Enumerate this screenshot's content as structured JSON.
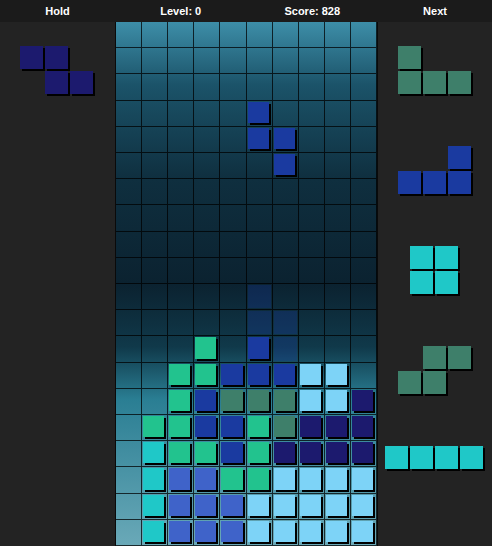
{
  "header": {
    "hold_label": "Hold",
    "level": "Level: 0",
    "score": "Score: 828",
    "next_label": "Next"
  },
  "hold": {
    "color": "#1c1a6e",
    "cells": [
      [
        0,
        0
      ],
      [
        1,
        0
      ],
      [
        1,
        1
      ],
      [
        2,
        1
      ]
    ]
  },
  "next": [
    {
      "color": "#3e7f6a",
      "cells": [
        [
          0,
          0
        ],
        [
          0,
          1
        ],
        [
          1,
          1
        ],
        [
          2,
          1
        ]
      ]
    },
    {
      "color": "#1a3aa0",
      "cells": [
        [
          2,
          0
        ],
        [
          0,
          1
        ],
        [
          1,
          1
        ],
        [
          2,
          1
        ]
      ]
    },
    {
      "color": "#1fc8c8",
      "cells": [
        [
          0,
          0
        ],
        [
          1,
          0
        ],
        [
          0,
          1
        ],
        [
          1,
          1
        ]
      ]
    },
    {
      "color": "#3e7f6a",
      "cells": [
        [
          1,
          0
        ],
        [
          2,
          0
        ],
        [
          0,
          1
        ],
        [
          1,
          1
        ]
      ]
    },
    {
      "color": "#1fc8c8",
      "cells": [
        [
          0,
          0
        ],
        [
          1,
          0
        ],
        [
          2,
          0
        ],
        [
          3,
          0
        ]
      ]
    }
  ],
  "active_piece": {
    "color": "#1a3aa0",
    "cells": [
      [
        5,
        3
      ],
      [
        5,
        4
      ],
      [
        6,
        4
      ],
      [
        6,
        5
      ]
    ]
  },
  "ghost": {
    "cells": [
      [
        5,
        10
      ],
      [
        5,
        11
      ],
      [
        6,
        11
      ],
      [
        6,
        12
      ]
    ]
  },
  "board": {
    "rows": [
      [
        "",
        "",
        "",
        "",
        "",
        "",
        "",
        "",
        "",
        ""
      ],
      [
        "",
        "",
        "",
        "",
        "",
        "",
        "",
        "",
        "",
        ""
      ],
      [
        "",
        "",
        "",
        "",
        "",
        "",
        "",
        "",
        "",
        ""
      ],
      [
        "",
        "",
        "",
        "",
        "",
        "",
        "",
        "",
        "",
        ""
      ],
      [
        "",
        "",
        "",
        "",
        "",
        "",
        "",
        "",
        "",
        ""
      ],
      [
        "",
        "",
        "",
        "",
        "",
        "",
        "",
        "",
        "",
        ""
      ],
      [
        "",
        "",
        "",
        "",
        "",
        "",
        "",
        "",
        "",
        ""
      ],
      [
        "",
        "",
        "",
        "",
        "",
        "",
        "",
        "",
        "",
        ""
      ],
      [
        "",
        "",
        "",
        "",
        "",
        "",
        "",
        "",
        "",
        ""
      ],
      [
        "",
        "",
        "",
        "",
        "",
        "",
        "",
        "",
        "",
        ""
      ],
      [
        "",
        "",
        "",
        "",
        "",
        "",
        "",
        "",
        "",
        ""
      ],
      [
        "",
        "",
        "",
        "",
        "",
        "",
        "",
        "",
        "",
        ""
      ],
      [
        "",
        "",
        "",
        "#22c38e",
        "",
        "#1a3aa0",
        "",
        "",
        "",
        ""
      ],
      [
        "",
        "",
        "#22c38e",
        "#22c38e",
        "#1a3aa0",
        "#1a3aa0",
        "#1a3aa0",
        "#7dd3f7",
        "#7dd3f7",
        ""
      ],
      [
        "",
        "",
        "#22c38e",
        "#1a3aa0",
        "#3e7f6a",
        "#3e7f6a",
        "#3e7f6a",
        "#7dd3f7",
        "#7dd3f7",
        "#1c1a6e"
      ],
      [
        "",
        "#22c38e",
        "#22c38e",
        "#1a3aa0",
        "#1a3aa0",
        "#22c38e",
        "#3e7f6a",
        "#1c1a6e",
        "#1c1a6e",
        "#1c1a6e"
      ],
      [
        "",
        "#1fc8c8",
        "#22c38e",
        "#22c38e",
        "#1a3aa0",
        "#22c38e",
        "#1c1a6e",
        "#1c1a6e",
        "#1c1a6e",
        "#1c1a6e"
      ],
      [
        "",
        "#1fc8c8",
        "#3f63c9",
        "#3f63c9",
        "#22c38e",
        "#22c38e",
        "#7dd3f7",
        "#7dd3f7",
        "#7dd3f7",
        "#7dd3f7"
      ],
      [
        "",
        "#1fc8c8",
        "#3f63c9",
        "#3f63c9",
        "#3f63c9",
        "#7dd3f7",
        "#7dd3f7",
        "#7dd3f7",
        "#7dd3f7",
        "#7dd3f7"
      ],
      [
        "",
        "#1fc8c8",
        "#3f63c9",
        "#3f63c9",
        "#3f63c9",
        "#7dd3f7",
        "#7dd3f7",
        "#7dd3f7",
        "#7dd3f7",
        "#7dd3f7"
      ]
    ]
  }
}
